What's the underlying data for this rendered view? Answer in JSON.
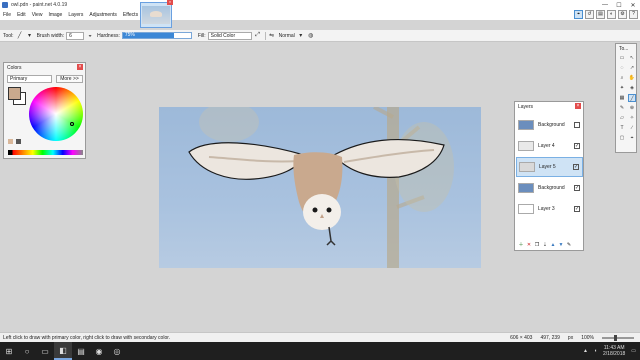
{
  "window": {
    "title": "owl.pdn - paint.net 4.0.19"
  },
  "menu": [
    "File",
    "Edit",
    "View",
    "Image",
    "Layers",
    "Adjustments",
    "Effects"
  ],
  "toolbar": {
    "tool_label": "Tool:",
    "brush_width_label": "Brush width:",
    "brush_width_value": "6",
    "hardness_label": "Hardness:",
    "hardness_value": "75%",
    "hardness_fraction": 0.75,
    "fill_label": "Fill:",
    "fill_value": "Solid Color",
    "blend_value": "Normal"
  },
  "colors_panel": {
    "title": "Colors",
    "mode": "Primary",
    "more_label": "More >>",
    "primary_color": "#c9a98e",
    "secondary_color": "#ffffff"
  },
  "tools_panel": {
    "title": "To...",
    "tools": [
      "select-rect-icon",
      "move-icon",
      "lasso-icon",
      "move-selection-icon",
      "zoom-icon",
      "pan-icon",
      "magic-wand-icon",
      "bucket-icon",
      "gradient-icon",
      "brush-icon",
      "pencil-icon",
      "clone-icon",
      "eraser-icon",
      "recolor-icon",
      "text-icon",
      "line-icon",
      "shapes-icon",
      "color-picker-icon"
    ]
  },
  "layers_panel": {
    "title": "Layers",
    "layers": [
      {
        "name": "Background",
        "checked": false,
        "thumb": "#6b8ebd"
      },
      {
        "name": "Layer 4",
        "checked": true,
        "thumb": "#e9e9e9"
      },
      {
        "name": "Layer 5",
        "checked": true,
        "thumb": "#d9d9d9",
        "selected": true
      },
      {
        "name": "Background",
        "checked": true,
        "thumb": "#6b8ebd"
      },
      {
        "name": "Layer 3",
        "checked": true,
        "thumb": "#ffffff"
      }
    ]
  },
  "status": {
    "hint": "Left click to draw with primary color, right click to draw with secondary color.",
    "size": "606 × 403",
    "position": "497, 239",
    "units": "px",
    "zoom": "100%"
  },
  "taskbar": {
    "time": "11:43 AM",
    "date": "2/18/2018"
  }
}
